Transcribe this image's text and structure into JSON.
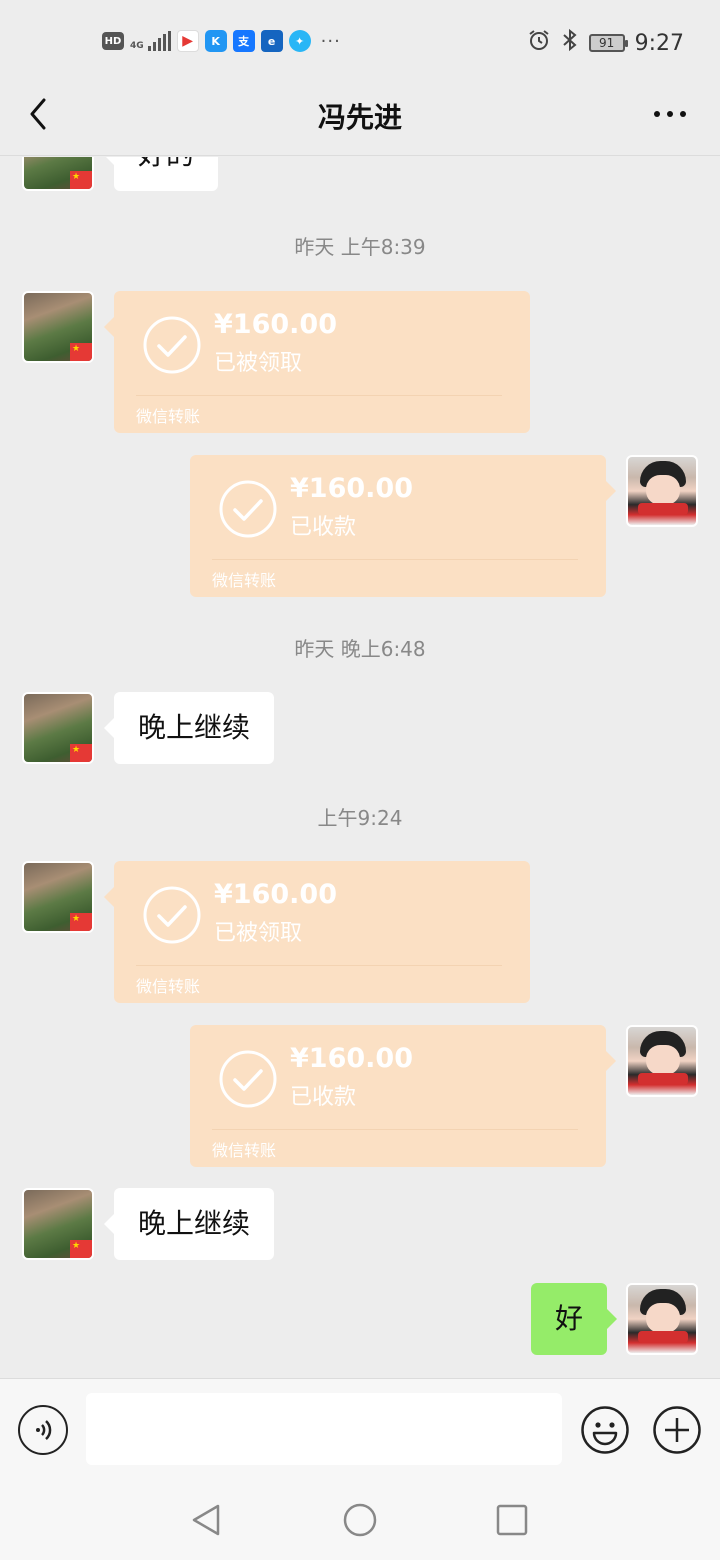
{
  "status_bar": {
    "left_icons": [
      "hd-badge",
      "signal-4g-icon",
      "app-icon-1",
      "app-icon-k",
      "alipay-icon",
      "app-icon-4",
      "app-icon-5"
    ],
    "hd_label": "HD",
    "network": "4G",
    "more": "···",
    "battery": "91",
    "time": "9:27"
  },
  "header": {
    "title": "冯先进"
  },
  "messages": [
    {
      "type": "text",
      "side": "left",
      "text": "好的"
    },
    {
      "type": "timestamp",
      "text": "昨天 上午8:39"
    },
    {
      "type": "transfer",
      "side": "left",
      "amount": "¥160.00",
      "status": "已被领取",
      "label": "微信转账"
    },
    {
      "type": "transfer",
      "side": "right",
      "amount": "¥160.00",
      "status": "已收款",
      "label": "微信转账"
    },
    {
      "type": "timestamp",
      "text": "昨天 晚上6:48"
    },
    {
      "type": "text",
      "side": "left",
      "text": "晚上继续"
    },
    {
      "type": "timestamp",
      "text": "上午9:24"
    },
    {
      "type": "transfer",
      "side": "left",
      "amount": "¥160.00",
      "status": "已被领取",
      "label": "微信转账"
    },
    {
      "type": "transfer",
      "side": "right",
      "amount": "¥160.00",
      "status": "已收款",
      "label": "微信转账"
    },
    {
      "type": "text",
      "side": "left",
      "text": "晚上继续"
    },
    {
      "type": "text",
      "side": "right",
      "text": "好"
    }
  ],
  "input": {
    "value": "",
    "placeholder": ""
  },
  "colors": {
    "background": "#ededed",
    "transfer_bubble": "#fbe0c4",
    "own_bubble": "#95ec69",
    "peer_bubble": "#ffffff"
  }
}
